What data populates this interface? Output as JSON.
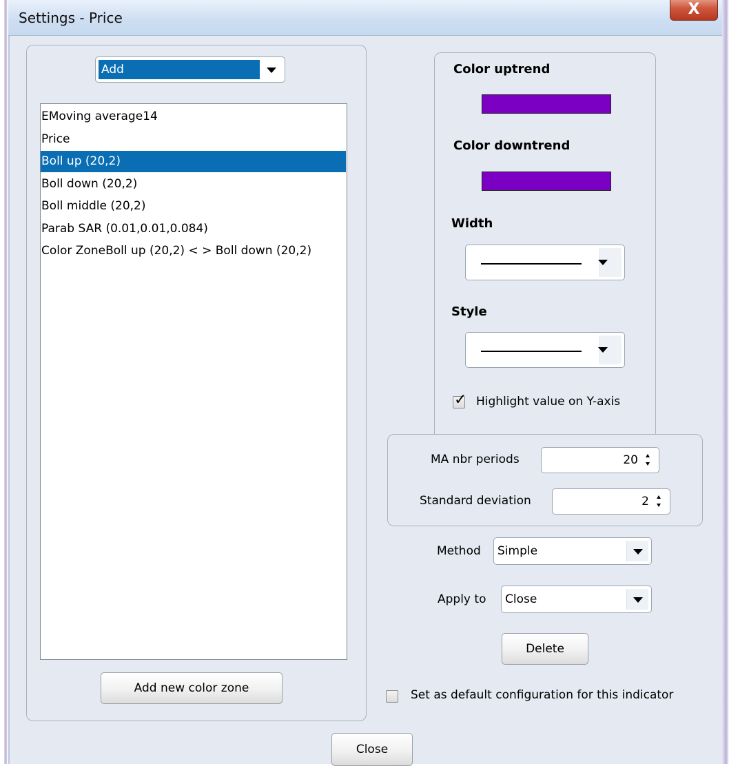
{
  "window": {
    "title": "Settings - Price",
    "close_glyph": "X"
  },
  "left": {
    "add_combo": {
      "value": "Add"
    },
    "indicators": [
      {
        "label": "EMoving average14",
        "selected": false
      },
      {
        "label": "Price",
        "selected": false
      },
      {
        "label": "Boll up (20,2)",
        "selected": true
      },
      {
        "label": "Boll down (20,2)",
        "selected": false
      },
      {
        "label": "Boll middle (20,2)",
        "selected": false
      },
      {
        "label": "Parab SAR (0.01,0.01,0.084)",
        "selected": false
      },
      {
        "label": "Color ZoneBoll up (20,2) < > Boll down (20,2)",
        "selected": false
      }
    ],
    "add_color_zone_label": "Add new color zone"
  },
  "style_panel": {
    "color_uptrend_label": "Color uptrend",
    "color_uptrend": "#7b00c4",
    "color_downtrend_label": "Color downtrend",
    "color_downtrend": "#7b00c4",
    "width_label": "Width",
    "style_label": "Style",
    "highlight_label": "Highlight value on Y-axis",
    "highlight_checked": true
  },
  "params": {
    "ma_periods_label": "MA nbr periods",
    "ma_periods_value": "20",
    "std_dev_label": "Standard deviation",
    "std_dev_value": "2"
  },
  "method": {
    "label": "Method",
    "value": "Simple"
  },
  "apply_to": {
    "label": "Apply to",
    "value": "Close"
  },
  "delete_label": "Delete",
  "default_config": {
    "label": "Set as default configuration for this indicator",
    "checked": false
  },
  "close_label": "Close"
}
